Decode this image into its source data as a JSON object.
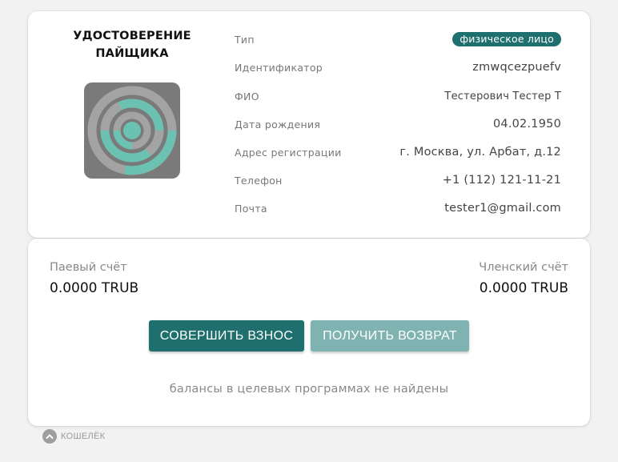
{
  "certificate": {
    "title_line1": "УДОСТОВЕРЕНИЕ",
    "title_line2": "ПАЙЩИКА",
    "fields": [
      {
        "label": "Тип",
        "value": "физическое лицо"
      },
      {
        "label": "Идентификатор",
        "value": "zmwqcezpuefv"
      },
      {
        "label": "ФИО",
        "value": "Тестерович Тестер Т"
      },
      {
        "label": "Дата рождения",
        "value": "04.02.1950"
      },
      {
        "label": "Адрес регистрации",
        "value": "г. Москва, ул. Арбат, д.12"
      },
      {
        "label": "Телефон",
        "value": "+1 (112) 121-11-21"
      },
      {
        "label": "Почта",
        "value": "tester1@gmail.com"
      }
    ]
  },
  "wallet": {
    "share_account_label": "Паевый счёт",
    "share_account_value": "0.0000 TRUB",
    "member_account_label": "Членский счёт",
    "member_account_value": "0.0000 TRUB",
    "deposit_button": "СОВЕРШИТЬ ВЗНОС",
    "refund_button": "ПОЛУЧИТЬ ВОЗВРАТ",
    "empty_note": "балансы в целевых программах не найдены"
  },
  "footer": {
    "collapse_label": "КОШЕЛЁК"
  },
  "colors": {
    "accent": "#1f6f6e",
    "accent_light": "#7fb3b1",
    "avatar_bg": "#7a7a7a",
    "avatar_ring": "#a3a3a3",
    "avatar_teal": "#6cc2b2"
  },
  "icons": {
    "avatar": "identicon-rings",
    "footer": "chevron-up-icon"
  }
}
